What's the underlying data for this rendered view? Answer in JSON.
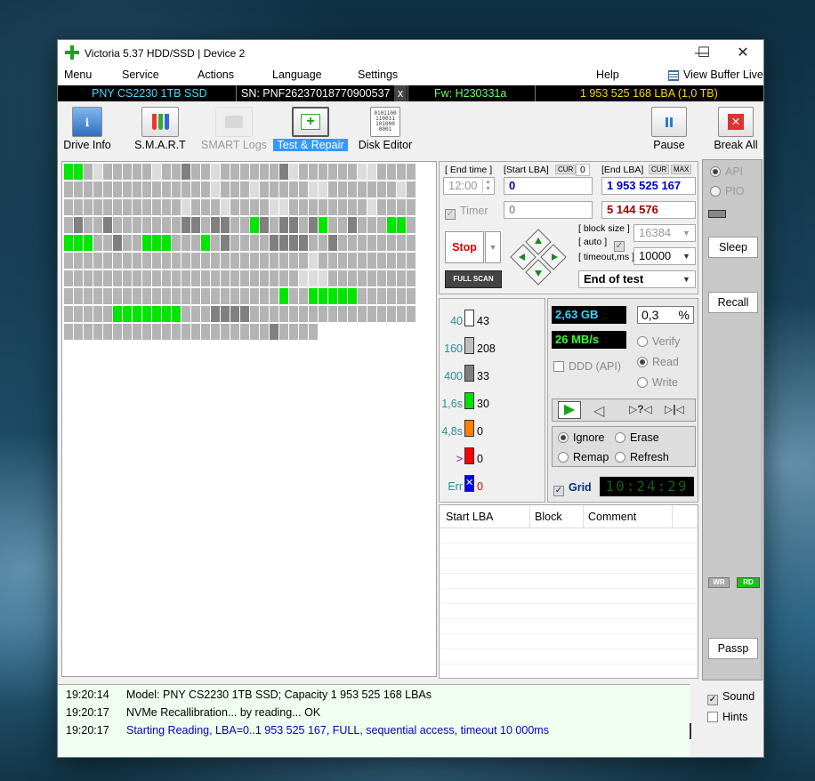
{
  "window": {
    "title": "Victoria 5.37 HDD/SSD | Device 2",
    "minimize": "—",
    "maximize": "☐",
    "close": "✕"
  },
  "menu": {
    "items": [
      "Menu",
      "Service",
      "Actions",
      "Language",
      "Settings"
    ],
    "help": "Help",
    "view_buffer": "View Buffer Live"
  },
  "info": {
    "model": "PNY CS2230 1TB SSD",
    "serial": "SN: PNF26237018770900537",
    "close_x": "x",
    "firmware": "Fw: H230331a",
    "capacity": "1 953 525 168 LBA (1,0 TB)"
  },
  "toolbar": {
    "drive_info": "Drive Info",
    "smart": "S.M.A.R.T",
    "smart_logs": "SMART Logs",
    "test_repair": "Test & Repair",
    "disk_editor": "Disk Editor",
    "pause": "Pause",
    "break_all": "Break All",
    "disk_editor_icon_text": "0101100\n110011\n101000\n0001"
  },
  "scan": {
    "end_time_label": "[ End time ]",
    "end_time_value": "12:00",
    "start_lba_label": "[Start LBA]",
    "cur_label": "CUR",
    "cur_value": "0",
    "start_lba_value": "0",
    "end_lba_label": "[End LBA]",
    "end_cur_label": "CUR",
    "max_label": "MAX",
    "end_lba_value": "1 953 525 167",
    "timer_label": "Timer",
    "timer_value": "0",
    "remain_value": "5 144 576",
    "stop_label": "Stop",
    "full_scan_label": "FULL SCAN",
    "block_size_label": "[ block size ]",
    "auto_label": "[ auto ]",
    "block_size_value": "16384",
    "timeout_label": "[ timeout,ms ]",
    "timeout_value": "10000",
    "end_action": "End of test"
  },
  "stats": {
    "rows": [
      {
        "label": "40",
        "count": "43",
        "color": "#ffffff"
      },
      {
        "label": "160",
        "count": "208",
        "color": "#c0c0c0"
      },
      {
        "label": "400",
        "count": "33",
        "color": "#808080"
      },
      {
        "label": "1,6s",
        "count": "30",
        "color": "#00e000"
      },
      {
        "label": "4,8s",
        "count": "0",
        "color": "#ff8000"
      },
      {
        "label": ">",
        "count": "0",
        "color": "#ff0000"
      },
      {
        "label": "Err",
        "count": "0",
        "color": "#0000ff"
      }
    ],
    "err_glyph": "✕"
  },
  "progress": {
    "size": "2,63 GB",
    "percent": "0,3",
    "percent_unit": "%",
    "speed": "26 MB/s"
  },
  "mode": {
    "verify": "Verify",
    "read": "Read",
    "write": "Write",
    "ddd": "DDD (API)"
  },
  "repair": {
    "ignore": "Ignore",
    "erase": "Erase",
    "remap": "Remap",
    "refresh": "Refresh",
    "grid": "Grid",
    "clock": "10:24:29"
  },
  "table": {
    "headers": [
      "Start LBA",
      "Block",
      "Comment"
    ]
  },
  "right": {
    "api": "API",
    "pio": "PIO",
    "sleep": "Sleep",
    "recall": "Recall",
    "wr": "WR",
    "rd": "RD",
    "passp": "Passp",
    "sound": "Sound",
    "hints": "Hints"
  },
  "log": [
    {
      "time": "19:20:14",
      "text": "Model: PNY CS2230 1TB SSD; Capacity 1 953 525 168 LBAs",
      "color": "#000000"
    },
    {
      "time": "19:20:17",
      "text": "NVMe Recallibration...  by reading... OK",
      "color": "#000000"
    },
    {
      "time": "19:20:17",
      "text": "Starting Reading, LBA=0..1 953 525 167, FULL, sequential access, timeout 10 000ms",
      "color": "#0000c0"
    }
  ],
  "grid_rows": [
    "GGGLGGGGGLGGDGGLGGGGGGDLGGGGGGLLGGGGG",
    "GGGGGGGGGGGGGGGLGGGLGGGGGLLGGGGGGGLGGGG",
    "GGGGGGGGGGGGLGGGLGGGGLLGGGGGGGGLGGGGGGG",
    "GDGGDGGGGGGGDDGDDGGGDGDDGDGGGDGGGGGGGGG",
    "GDDGGDGGGGDGGGGGDGGGGDDDDGGDGGGGGGGGDGG",
    "GGGGGGGGGGGGGGGGGGGGGGGGGLGGGGGGGGGGGGG",
    "GGGGGGGGGGGGGGGGGGGGGGGGLLLGGGGGGGGGGGG",
    "GGGGGGGGGGGGGGGGGGGGGGGGGGGGGGGGGGGGGGG",
    "GGGGGGGGGGGGGGGDDDDGGGGGGGGGGGGGGGGGGGG",
    "GGGGGGGGGGGGGGGGGGGGGDGGGGGGGGGGGGGGGG"
  ]
}
